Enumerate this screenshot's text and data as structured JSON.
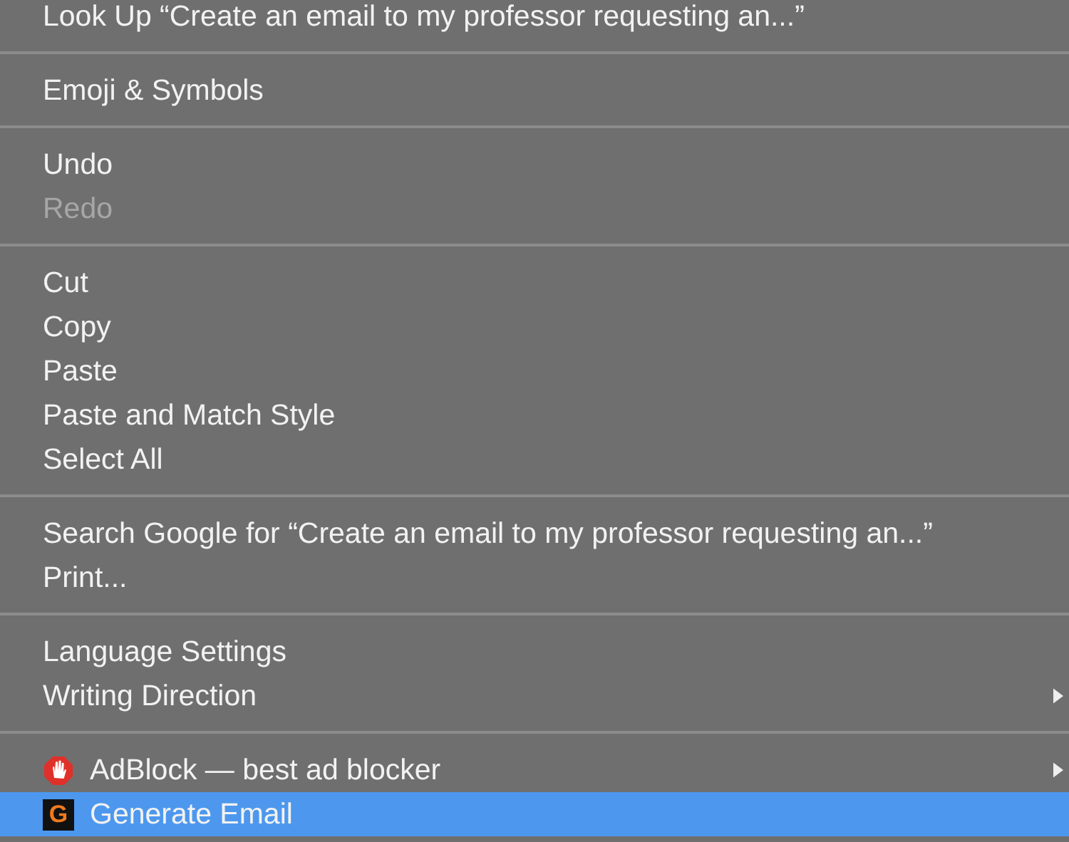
{
  "menu": {
    "groups": [
      {
        "items": [
          {
            "label": "Look Up “Create an email to my professor requesting an...”",
            "disabled": false,
            "submenu": false,
            "selected": false
          }
        ]
      },
      {
        "items": [
          {
            "label": "Emoji & Symbols",
            "disabled": false,
            "submenu": false,
            "selected": false
          }
        ]
      },
      {
        "items": [
          {
            "label": "Undo",
            "disabled": false,
            "submenu": false,
            "selected": false
          },
          {
            "label": "Redo",
            "disabled": true,
            "submenu": false,
            "selected": false
          }
        ]
      },
      {
        "items": [
          {
            "label": "Cut",
            "disabled": false,
            "submenu": false,
            "selected": false
          },
          {
            "label": "Copy",
            "disabled": false,
            "submenu": false,
            "selected": false
          },
          {
            "label": "Paste",
            "disabled": false,
            "submenu": false,
            "selected": false
          },
          {
            "label": "Paste and Match Style",
            "disabled": false,
            "submenu": false,
            "selected": false
          },
          {
            "label": "Select All",
            "disabled": false,
            "submenu": false,
            "selected": false
          }
        ]
      },
      {
        "items": [
          {
            "label": "Search Google for “Create an email to my professor requesting an...”",
            "disabled": false,
            "submenu": false,
            "selected": false
          },
          {
            "label": "Print...",
            "disabled": false,
            "submenu": false,
            "selected": false
          }
        ]
      },
      {
        "items": [
          {
            "label": "Language Settings",
            "disabled": false,
            "submenu": false,
            "selected": false
          },
          {
            "label": "Writing Direction",
            "disabled": false,
            "submenu": true,
            "selected": false
          }
        ]
      },
      {
        "items": [
          {
            "label": "AdBlock — best ad blocker",
            "disabled": false,
            "submenu": true,
            "selected": false,
            "icon": {
              "kind": "hand"
            }
          },
          {
            "label": "Generate Email",
            "disabled": false,
            "submenu": false,
            "selected": true,
            "icon": {
              "kind": "letter",
              "text": "G"
            }
          }
        ]
      }
    ]
  }
}
